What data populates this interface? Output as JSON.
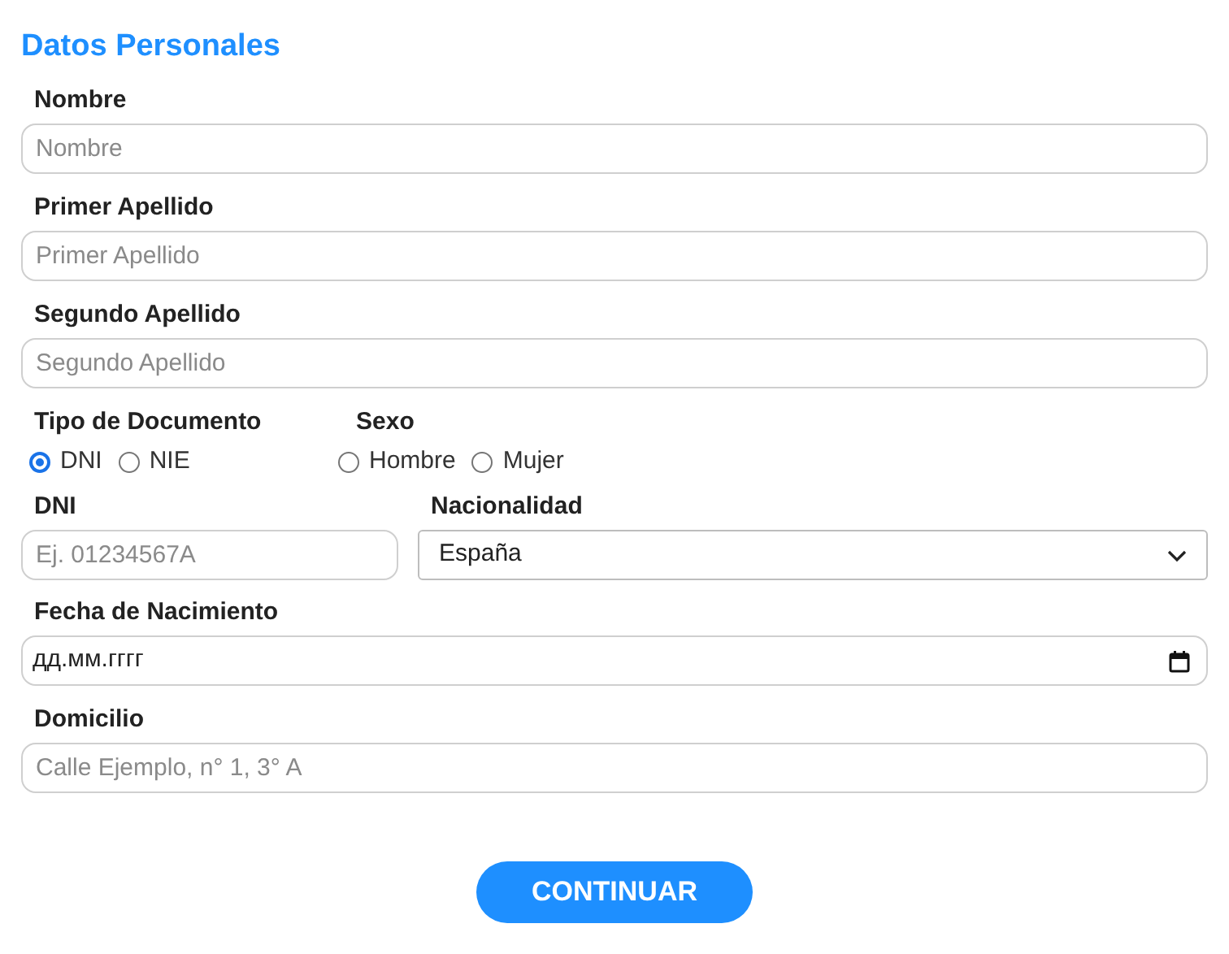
{
  "title": "Datos Personales",
  "sections": [
    {
      "kind": "text",
      "label": "Nombre",
      "placeholder": "Nombre"
    },
    {
      "kind": "text",
      "label": "Primer Apellido",
      "placeholder": "Primer Apellido"
    },
    {
      "kind": "text",
      "label": "Segundo Apellido",
      "placeholder": "Segundo Apellido"
    },
    {
      "kind": "radios",
      "groups": [
        {
          "label": "Tipo de Documento",
          "options": [
            {
              "label": "DNI",
              "selected": true
            },
            {
              "label": "NIE",
              "selected": false
            }
          ]
        },
        {
          "label": "Sexo",
          "options": [
            {
              "label": "Hombre",
              "selected": false
            },
            {
              "label": "Mujer",
              "selected": false
            }
          ]
        }
      ]
    },
    {
      "kind": "pair",
      "fields": [
        {
          "kind": "text",
          "label": "DNI",
          "placeholder": "Ej. 01234567A"
        },
        {
          "kind": "select",
          "label": "Nacionalidad",
          "value": "España"
        }
      ]
    },
    {
      "kind": "date",
      "label": "Fecha de Nacimiento",
      "placeholder": "дд.мм.гггг"
    },
    {
      "kind": "text",
      "label": "Domicilio",
      "placeholder": "Calle Ejemplo, n° 1, 3° A"
    }
  ],
  "button": "CONTINUAR"
}
